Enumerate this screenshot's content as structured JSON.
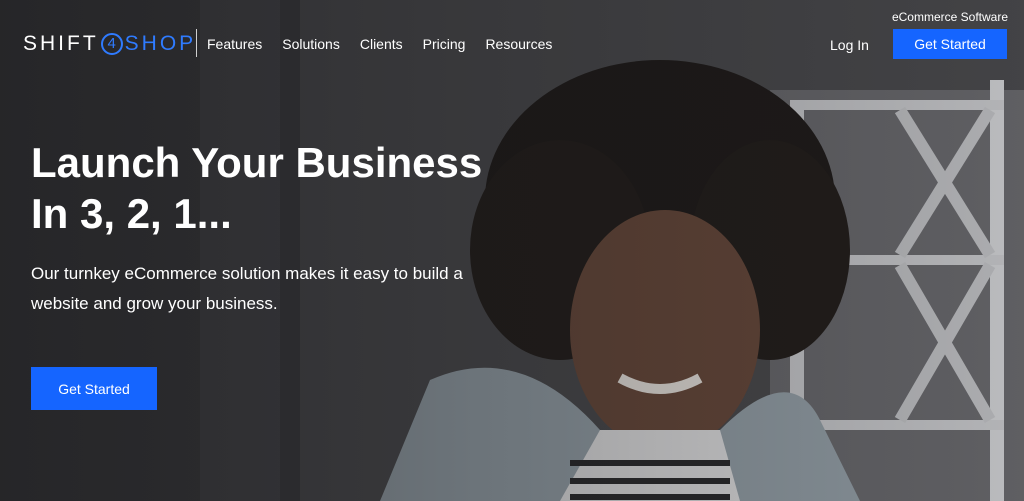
{
  "header": {
    "logo": {
      "part1": "SHIFT",
      "part2": "4",
      "part3": "SHOP"
    },
    "nav": [
      "Features",
      "Solutions",
      "Clients",
      "Pricing",
      "Resources"
    ],
    "tagline": "eCommerce Software",
    "login_label": "Log In",
    "cta_label": "Get Started"
  },
  "hero": {
    "headline_line1": "Launch Your Business",
    "headline_line2": "In 3, 2, 1...",
    "subcopy": "Our turnkey eCommerce solution makes it easy to build a website and grow your business.",
    "cta_label": "Get Started"
  },
  "colors": {
    "accent": "#1565ff",
    "logo_accent": "#2f7bff"
  }
}
